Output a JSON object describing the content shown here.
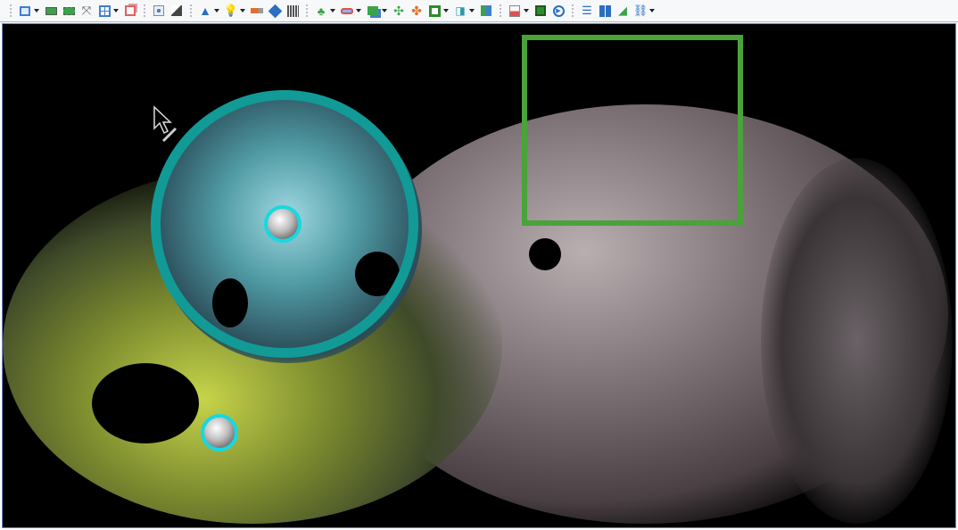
{
  "toolbar": {
    "groups": [
      [
        "view-cube-icon",
        "fit-view-icon",
        "zoom-extents-icon",
        "zoom-selection-icon",
        "view-grid-icon",
        "box-view-icon"
      ],
      [
        "section-box-icon",
        "clip-icon"
      ],
      [
        "point-display-icon",
        "lighting-icon",
        "flashlight-icon",
        "color-tag-icon",
        "grid-icon"
      ],
      [
        "classify-icon",
        "scan-icon",
        "region-icon",
        "align-icon",
        "measure-icon",
        "frame-icon",
        "mirror-icon",
        "cluster-icon"
      ],
      [
        "document-icon",
        "map-icon",
        "play-icon"
      ],
      [
        "list-icon",
        "split-view-icon",
        "terrain-icon",
        "link-icon"
      ]
    ]
  },
  "viewport": {
    "ring_color": "#129a96",
    "selection_color": "#4aa23a",
    "marker_color": "#18d8e0"
  }
}
